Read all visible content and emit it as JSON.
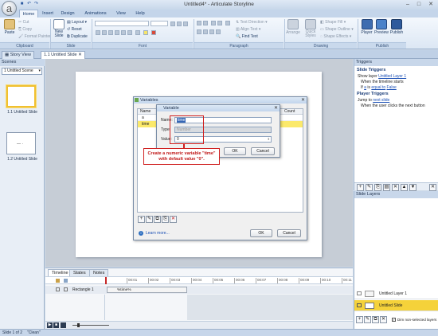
{
  "window": {
    "title": "Untitled4* - Articulate Storyline",
    "minimize": "–",
    "maximize": "□",
    "close": "✕"
  },
  "quick_access": {
    "save": "■",
    "undo": "↶",
    "redo": "↷"
  },
  "ribbon_tabs": [
    "Home",
    "Insert",
    "Design",
    "Animations",
    "View",
    "Help"
  ],
  "ribbon": {
    "clipboard": {
      "paste": "Paste",
      "cut": "Cut",
      "copy": "Copy",
      "format_painter": "Format Painter",
      "group": "Clipboard"
    },
    "slide": {
      "new_slide": "New Slide",
      "layout": "Layout",
      "reset": "Reset",
      "duplicate": "Duplicate",
      "group": "Slide"
    },
    "font": {
      "group": "Font"
    },
    "paragraph": {
      "text_direction": "Text Direction",
      "align_text": "Align Text",
      "find_text": "Find Text",
      "group": "Paragraph"
    },
    "drawing": {
      "arrange": "Arrange",
      "quick_styles": "Quick Styles",
      "shape_fill": "Shape Fill",
      "shape_outline": "Shape Outline",
      "shape_effects": "Shape Effects",
      "group": "Drawing"
    },
    "publish": {
      "player": "Player",
      "preview": "Preview",
      "publish": "Publish",
      "group": "Publish"
    }
  },
  "doc_tabs": {
    "story_view": "Story View",
    "slide": "1.1 Untitled Slide"
  },
  "scenes": {
    "header": "Scenes",
    "select": "1 Untitled Scene",
    "slides": [
      {
        "label": "1.1 Untitled Slide"
      },
      {
        "label": "1.2 Untitled Slide"
      }
    ],
    "slide2_mark": "— ·"
  },
  "variables_dialog": {
    "title": "Variables",
    "columns": {
      "name": "Name",
      "count": "Count"
    },
    "rows": [
      {
        "name": "a"
      },
      {
        "name": "time"
      }
    ],
    "learn_more": "Learn more...",
    "ok": "OK",
    "cancel": "Cancel",
    "info_icon": "i"
  },
  "variable_dialog": {
    "title": "Variable",
    "name_label": "Name:",
    "name_value": "time",
    "type_label": "Type:",
    "type_value": "Number",
    "value_label": "Value:",
    "value_value": "0",
    "ok": "OK",
    "cancel": "Cancel"
  },
  "annotation": {
    "line1": "Create a numeric variable \"time\"",
    "line2": "with default value \"0\"."
  },
  "triggers": {
    "header": "Triggers",
    "slide_triggers": "Slide Triggers",
    "t1_prefix": "Show layer",
    "t1_link": "Untitled Layer 1",
    "t1_when": "When the timeline starts",
    "t1_cond_prefix": "If",
    "t1_cond_a": "a",
    "t1_cond_op": "is",
    "t1_cond_eq": "equal to",
    "t1_cond_val": "False",
    "player_triggers": "Player Triggers",
    "t2_prefix": "Jump to",
    "t2_link": "next slide",
    "t2_when": "When the user clicks the next button"
  },
  "slide_layers": {
    "header": "Slide Layers",
    "layers": [
      "Untitled Layer 1",
      "Untitled Slide"
    ],
    "dim_label": "Dim non-selected layers"
  },
  "timeline": {
    "tabs": [
      "Timeline",
      "States",
      "Notes"
    ],
    "row_label": "Rectangle 1",
    "row_text": "%time%",
    "ticks": [
      "",
      "00:01",
      "00:02",
      "00:03",
      "00:04",
      "00:05",
      "00:06",
      "00:07",
      "00:08",
      "00:09",
      "00:10",
      "00:11"
    ]
  },
  "status": {
    "slide": "Slide 1 of 2",
    "theme": "\"Clean\""
  }
}
